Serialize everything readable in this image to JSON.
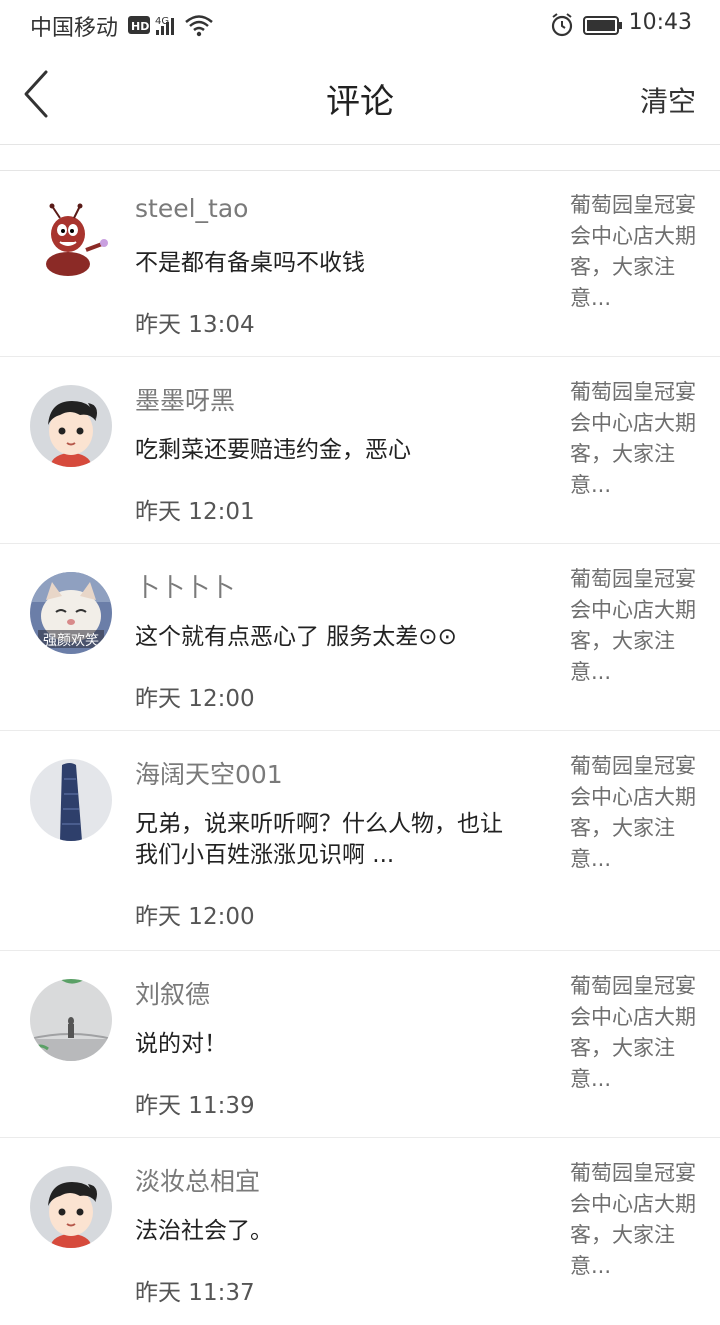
{
  "status_bar": {
    "carrier": "中国移动",
    "network": "4G",
    "time": "10:43"
  },
  "nav": {
    "title": "评论",
    "clear_label": "清空"
  },
  "comments": [
    {
      "username": "steel_tao",
      "text": "不是都有备桌吗不收钱",
      "time": "昨天 13:04",
      "reference": "葡萄园皇冠宴会中心店大期客，大家注意..."
    },
    {
      "username": "墨墨呀黑",
      "text": "吃剩菜还要赔违约金，恶心",
      "time": "昨天 12:01",
      "reference": "葡萄园皇冠宴会中心店大期客，大家注意..."
    },
    {
      "username": "卜卜卜卜",
      "text": "这个就有点恶心了 服务太差⊙⊙",
      "time": "昨天 12:00",
      "reference": "葡萄园皇冠宴会中心店大期客，大家注意...",
      "avatar_caption": "强颜欢笑"
    },
    {
      "username": "海阔天空001",
      "text": "兄弟，说来听听啊？什么人物，也让我们小百姓涨涨见识啊 ...",
      "time": "昨天 12:00",
      "reference": "葡萄园皇冠宴会中心店大期客，大家注意..."
    },
    {
      "username": "刘叙德",
      "text": "说的对！",
      "time": "昨天 11:39",
      "reference": "葡萄园皇冠宴会中心店大期客，大家注意..."
    },
    {
      "username": "淡妆总相宜",
      "text": "法治社会了。",
      "time": "昨天 11:37",
      "reference": "葡萄园皇冠宴会中心店大期客，大家注意..."
    }
  ]
}
